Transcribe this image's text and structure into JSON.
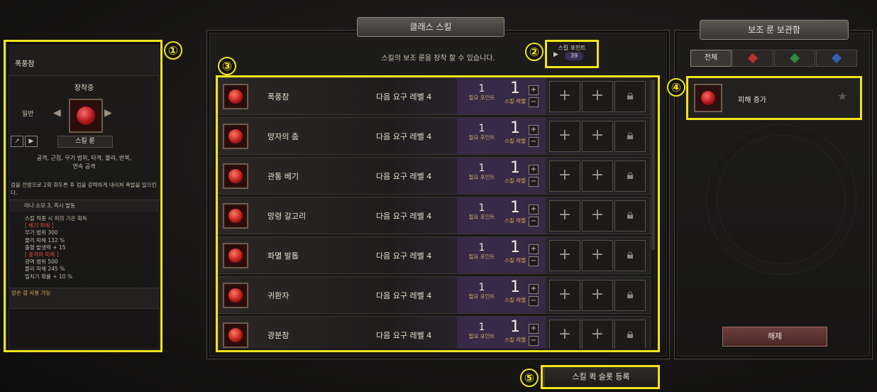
{
  "left_panel": {
    "skill_name": "폭풍참",
    "equip_status": "장착중",
    "grade": "일반",
    "rune_label": "스킬 룬",
    "tags_line1": "공격, 근접, 무기 범위, 타격, 물리, 반복,",
    "tags_line2": "연속 공격",
    "description": "검을 전방으로 2회 휘두른 후 검을 강력하게 내리쳐 폭발을 일으킨다.",
    "mana": "마나 소모 3, 즉시 발동",
    "stats": [
      {
        "text": "스킬 적중 시 피의 기운 획득",
        "style": ""
      },
      {
        "text": "[ 베기 피해 ]",
        "style": "red"
      },
      {
        "text": "무기 범위 300",
        "style": ""
      },
      {
        "text": "물리 피해 132 %",
        "style": ""
      },
      {
        "text": "출혈 발생력 + 15",
        "style": ""
      },
      {
        "text": "[ 충격파 피해 ]",
        "style": "red"
      },
      {
        "text": "광역 범위 500",
        "style": ""
      },
      {
        "text": "물리 피해 245 %",
        "style": ""
      },
      {
        "text": "밀치기 확률 + 10 %",
        "style": ""
      }
    ],
    "two_hand": "양손 검 사용 가능"
  },
  "center_panel": {
    "title": "클래스 스킬",
    "subtitle": "스킬의 보조 룬을 장착 할 수 있습니다.",
    "skill_points_label": "스킬 포인트",
    "skill_points_value": "39",
    "skills": [
      {
        "name": "폭풍참",
        "req": "다음 요구 레벨 4",
        "points": "1",
        "points_label": "필요 포인트",
        "level": "1",
        "level_label": "스킬 레벨"
      },
      {
        "name": "망자의 춤",
        "req": "다음 요구 레벨 4",
        "points": "1",
        "points_label": "필요 포인트",
        "level": "1",
        "level_label": "스킬 레벨"
      },
      {
        "name": "관통 베기",
        "req": "다음 요구 레벨 4",
        "points": "1",
        "points_label": "필요 포인트",
        "level": "1",
        "level_label": "스킬 레벨"
      },
      {
        "name": "망령 갈고리",
        "req": "다음 요구 레벨 4",
        "points": "1",
        "points_label": "필요 포인트",
        "level": "1",
        "level_label": "스킬 레벨"
      },
      {
        "name": "파멸 발톱",
        "req": "다음 요구 레벨 4",
        "points": "1",
        "points_label": "필요 포인트",
        "level": "1",
        "level_label": "스킬 레벨"
      },
      {
        "name": "귀환자",
        "req": "다음 요구 레벨 4",
        "points": "1",
        "points_label": "필요 포인트",
        "level": "1",
        "level_label": "스킬 레벨"
      },
      {
        "name": "광분참",
        "req": "다음 요구 레벨 4",
        "points": "1",
        "points_label": "필요 포인트",
        "level": "1",
        "level_label": "스킬 레벨"
      }
    ],
    "quick_slot_button": "스킬 퀵 슬롯 등록"
  },
  "right_panel": {
    "title": "보조 룬 보관함",
    "tab_all": "전체",
    "tab_colors": [
      "#b8322a",
      "#2f8a3a",
      "#2f5fb8"
    ],
    "rune_name": "피해 증가",
    "release_button": "해제"
  },
  "callouts": [
    "①",
    "②",
    "③",
    "④",
    "⑤"
  ]
}
